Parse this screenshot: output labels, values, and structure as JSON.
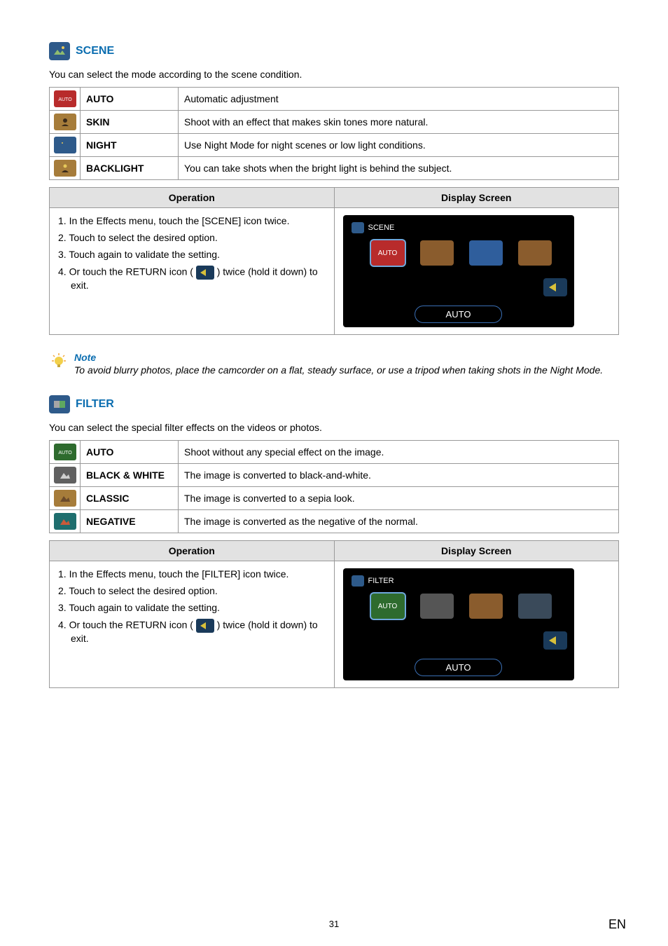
{
  "scene": {
    "title": "SCENE",
    "desc": "You can select the mode according to the scene condition.",
    "rows": [
      {
        "label": "AUTO",
        "text": "Automatic adjustment"
      },
      {
        "label": "SKIN",
        "text": "Shoot with an effect that makes skin tones more natural."
      },
      {
        "label": "NIGHT",
        "text": "Use Night Mode for night scenes or low light conditions."
      },
      {
        "label": "BACKLIGHT",
        "text": "You can take shots when the bright light is behind the subject."
      }
    ],
    "op_header": "Operation",
    "disp_header": "Display Screen",
    "steps": {
      "s1": "1.  In the Effects menu, touch the [SCENE] icon twice.",
      "s2": "2.  Touch to select the desired option.",
      "s3": "3.  Touch again to validate the setting.",
      "s4a": "4.  Or touch the RETURN icon ( ",
      "s4b": " ) twice (hold it down) to exit."
    },
    "screen_label": "SCENE",
    "pill": "AUTO",
    "auto_tile": "AUTO"
  },
  "note": {
    "title": "Note",
    "text": "To avoid blurry photos, place the camcorder on a flat, steady surface, or use a tripod when taking shots in the Night Mode."
  },
  "filter": {
    "title": "FILTER",
    "desc": "You can select the special filter effects on the videos or photos.",
    "rows": [
      {
        "label": "AUTO",
        "text": "Shoot without any special effect on the image."
      },
      {
        "label": "BLACK & WHITE",
        "text": "The image is converted to black-and-white."
      },
      {
        "label": "CLASSIC",
        "text": "The image is converted to a sepia look."
      },
      {
        "label": "NEGATIVE",
        "text": "The image is converted as the negative of the normal."
      }
    ],
    "op_header": "Operation",
    "disp_header": "Display Screen",
    "steps": {
      "s1": "1.  In the Effects menu, touch the [FILTER] icon twice.",
      "s2": "2.  Touch to select the desired option.",
      "s3": "3.  Touch again to validate the setting.",
      "s4a": "4.  Or touch the RETURN icon ( ",
      "s4b": " ) twice (hold it down) to exit."
    },
    "screen_label": "FILTER",
    "pill": "AUTO",
    "auto_tile": "AUTO"
  },
  "page_num": "31",
  "lang": "EN"
}
